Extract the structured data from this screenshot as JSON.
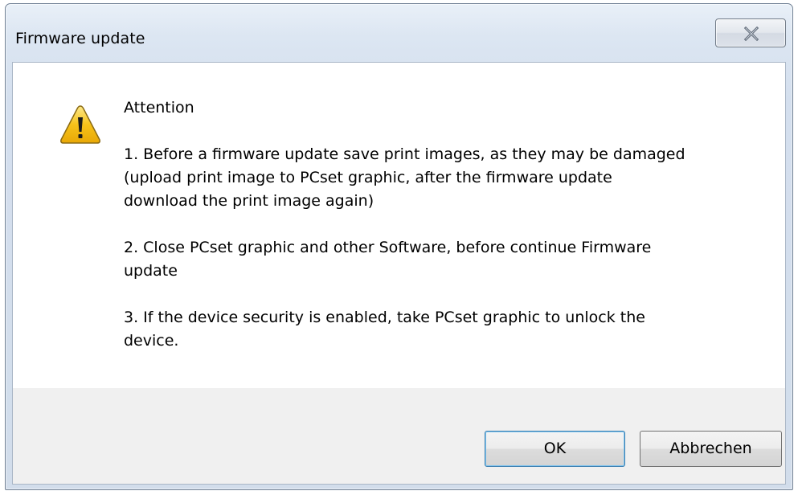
{
  "window": {
    "title": "Firmware update"
  },
  "message": {
    "heading": "Attention",
    "point1": "1. Before a firmware update save print images, as they may be damaged\n(upload print image to PCset graphic, after the firmware update\ndownload the print image again)",
    "point2": "2. Close PCset graphic and other Software, before continue Firmware\nupdate",
    "point3": "3. If the device security is enabled, take PCset graphic to unlock the\ndevice."
  },
  "buttons": {
    "ok_label": "OK",
    "cancel_label": "Abbrechen"
  },
  "icons": {
    "close": "close-icon",
    "warning": "warning-icon"
  },
  "colors": {
    "warning_fill": "#f6c21a",
    "default_button_border": "#3c7fb1"
  }
}
